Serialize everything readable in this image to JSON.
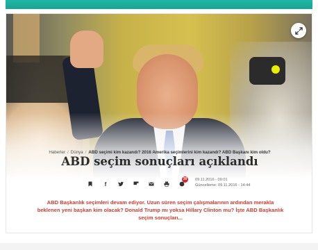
{
  "article": {
    "breadcrumb": [
      "Haberler",
      "Dünya",
      "ABD seçimi kim kazandı? 2016 Amerika seçimlerini kim kazandı? ABD Başkanı kim oldu?"
    ],
    "title": "ABD seçim sonuçları açıklandı",
    "published": "09.11.2016 - 09:01",
    "updated": "Güncelleme: 09.11.2016 - 14:44",
    "comment_count": "39",
    "summary": "ABD Başkanlık seçimleri devam ediyor. Uzun süren seçim çalışmalarının ardından merakla beklenen yeni başkan kim olacak? Donald Trump mı yoksa Hillary Clinton mu? İşte ABD Başkanlık seçim sonuçları..."
  },
  "share_icons": [
    "bookmark-icon",
    "facebook-icon",
    "twitter-icon",
    "flipboard-icon",
    "email-icon",
    "print-icon",
    "comment-icon"
  ],
  "colors": {
    "accent_teal": "#1fb5a4",
    "summary_red": "#d03a2f",
    "badge_red": "#d9262b"
  }
}
